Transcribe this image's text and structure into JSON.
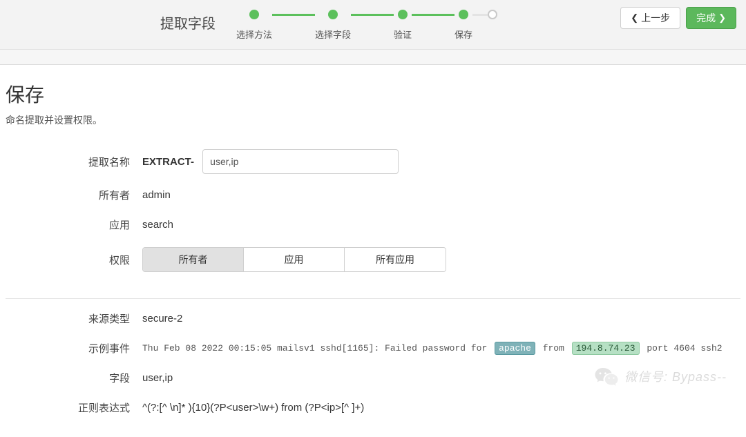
{
  "header": {
    "title": "提取字段",
    "steps": [
      {
        "label": "选择方法",
        "done": true
      },
      {
        "label": "选择字段",
        "done": true
      },
      {
        "label": "验证",
        "done": true
      },
      {
        "label": "保存",
        "done": true
      }
    ],
    "prev_label": "上一步",
    "finish_label": "完成"
  },
  "page": {
    "title": "保存",
    "subtitle": "命名提取并设置权限。"
  },
  "form": {
    "extract_name_label": "提取名称",
    "extract_prefix": "EXTRACT-",
    "extract_name_value": "user,ip",
    "owner_label": "所有者",
    "owner_value": "admin",
    "app_label": "应用",
    "app_value": "search",
    "perm_label": "权限",
    "perm_options": [
      "所有者",
      "应用",
      "所有应用"
    ],
    "perm_selected": "所有者"
  },
  "details": {
    "sourcetype_label": "来源类型",
    "sourcetype_value": "secure-2",
    "sample_label": "示例事件",
    "sample_event": {
      "pre": "Thu Feb 08 2022 00:15:05 mailsv1 sshd[1165]: Failed password for ",
      "user": "apache",
      "mid": " from ",
      "ip": "194.8.74.23",
      "post": " port 4604 ssh2"
    },
    "fields_label": "字段",
    "fields_value": "user,ip",
    "regex_label": "正则表达式",
    "regex_value": "^(?:[^ \\n]* ){10}(?P<user>\\w+) from (?P<ip>[^ ]+)"
  },
  "watermark": {
    "prefix": "微信号: Bypass--"
  }
}
